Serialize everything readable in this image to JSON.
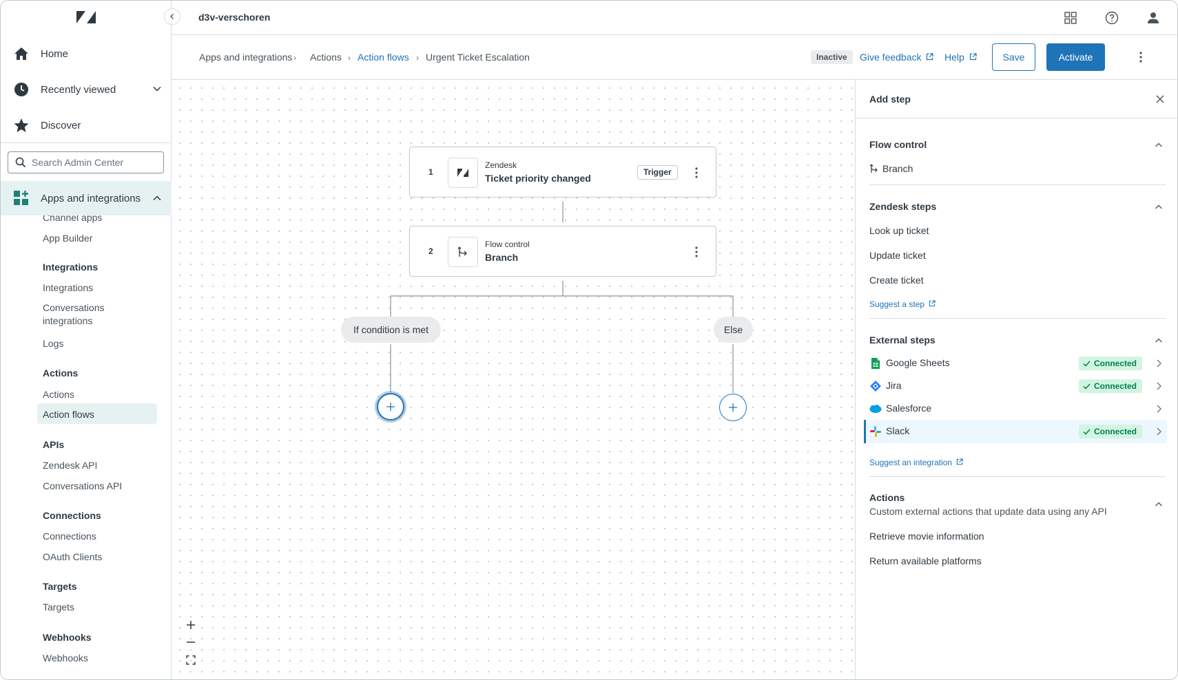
{
  "sidebar": {
    "home": "Home",
    "recently_viewed": "Recently viewed",
    "discover": "Discover",
    "search_placeholder": "Search Admin Center",
    "apps_integrations": "Apps and integrations",
    "channel_apps": "Channel apps",
    "app_builder": "App Builder",
    "integrations_head": "Integrations",
    "integrations": "Integrations",
    "conversations_integrations_1": "Conversations",
    "conversations_integrations_2": "integrations",
    "logs": "Logs",
    "actions_head": "Actions",
    "actions": "Actions",
    "action_flows": "Action flows",
    "apis_head": "APIs",
    "zendesk_api": "Zendesk API",
    "conversations_api": "Conversations API",
    "connections_head": "Connections",
    "connections": "Connections",
    "oauth_clients": "OAuth Clients",
    "targets_head": "Targets",
    "targets": "Targets",
    "webhooks_head": "Webhooks",
    "webhooks": "Webhooks"
  },
  "topbar": {
    "account": "d3v-verschoren"
  },
  "header": {
    "breadcrumb": [
      "Apps and integrations",
      "Actions",
      "Action flows",
      "Urgent Ticket Escalation"
    ],
    "status": "Inactive",
    "give_feedback": "Give feedback",
    "help": "Help",
    "save": "Save",
    "activate": "Activate"
  },
  "flow": {
    "steps": [
      {
        "number": "1",
        "category": "Zendesk",
        "title": "Ticket priority changed",
        "tag": "Trigger"
      },
      {
        "number": "2",
        "category": "Flow control",
        "title": "Branch"
      }
    ],
    "branch_if": "If condition is met",
    "branch_else": "Else"
  },
  "panel": {
    "title": "Add step",
    "flow_control": {
      "title": "Flow control",
      "items": [
        "Branch"
      ]
    },
    "zendesk_steps": {
      "title": "Zendesk steps",
      "items": [
        "Look up ticket",
        "Update ticket",
        "Create ticket"
      ],
      "suggest": "Suggest a step"
    },
    "external_steps": {
      "title": "External steps",
      "items": [
        {
          "name": "Google Sheets",
          "status": "Connected"
        },
        {
          "name": "Jira",
          "status": "Connected"
        },
        {
          "name": "Salesforce",
          "status": ""
        },
        {
          "name": "Slack",
          "status": "Connected"
        }
      ],
      "suggest": "Suggest an integration"
    },
    "actions": {
      "title": "Actions",
      "description": "Custom external actions that update data using any API",
      "items": [
        "Retrieve movie information",
        "Return available platforms"
      ]
    }
  },
  "colors": {
    "accent": "#1f73b7",
    "sidebar_active": "#e6f2f1",
    "connected_bg": "#d1f5e0",
    "connected_text": "#037f52"
  }
}
